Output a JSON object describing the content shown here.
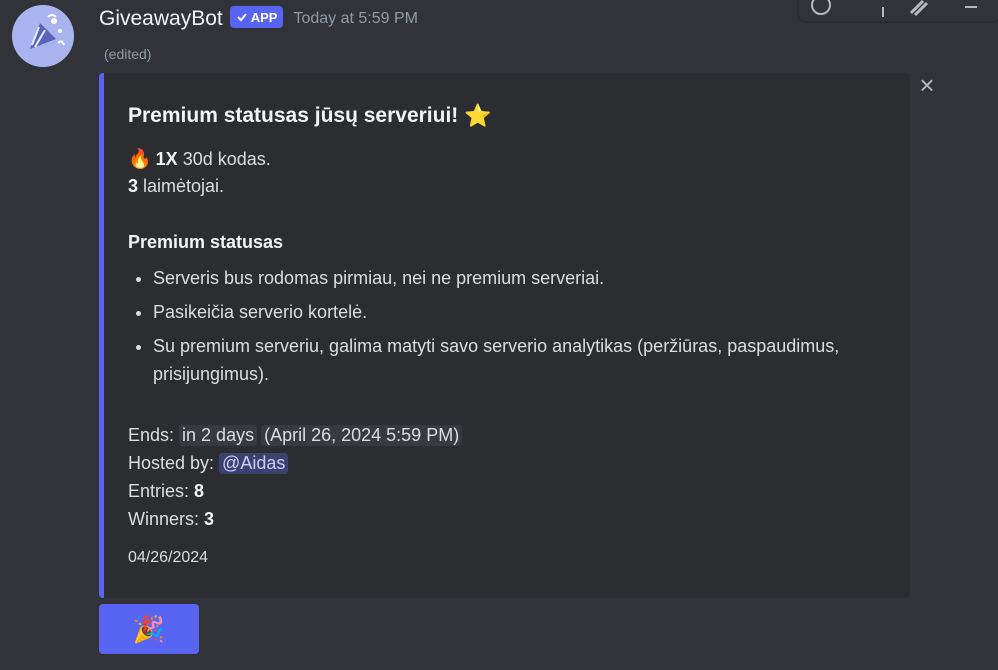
{
  "message": {
    "username": "GiveawayBot",
    "app_badge": "APP",
    "timestamp": "Today at 5:59 PM",
    "edited": "(edited)"
  },
  "embed": {
    "title": "Premium statusas jūsų serveriui!",
    "title_emoji": "⭐",
    "prize_emoji": "🔥",
    "prize_count": "1X",
    "prize_text": "30d kodas.",
    "winners_count": "3",
    "winners_text": "laimėtojai.",
    "section_heading": "Premium statusas",
    "benefits": [
      "Serveris bus rodomas pirmiau, nei ne premium serveriai.",
      "Pasikeičia serverio kortelė.",
      "Su premium serveriu, galima matyti savo serverio analytikas (peržiūras, paspaudimus, prisijungimus)."
    ],
    "ends_label": "Ends:",
    "ends_relative": "in 2 days",
    "ends_absolute": "April 26, 2024 5:59 PM",
    "hosted_label": "Hosted by:",
    "hosted_mention": "@Aidas",
    "entries_label": "Entries:",
    "entries_value": "8",
    "winners_label": "Winners:",
    "winners_value": "3",
    "footer_date": "04/26/2024"
  },
  "button": {
    "emoji": "🎉"
  },
  "colors": {
    "accent": "#5865f2",
    "background": "#313338",
    "embed_bg": "#2b2d31"
  }
}
